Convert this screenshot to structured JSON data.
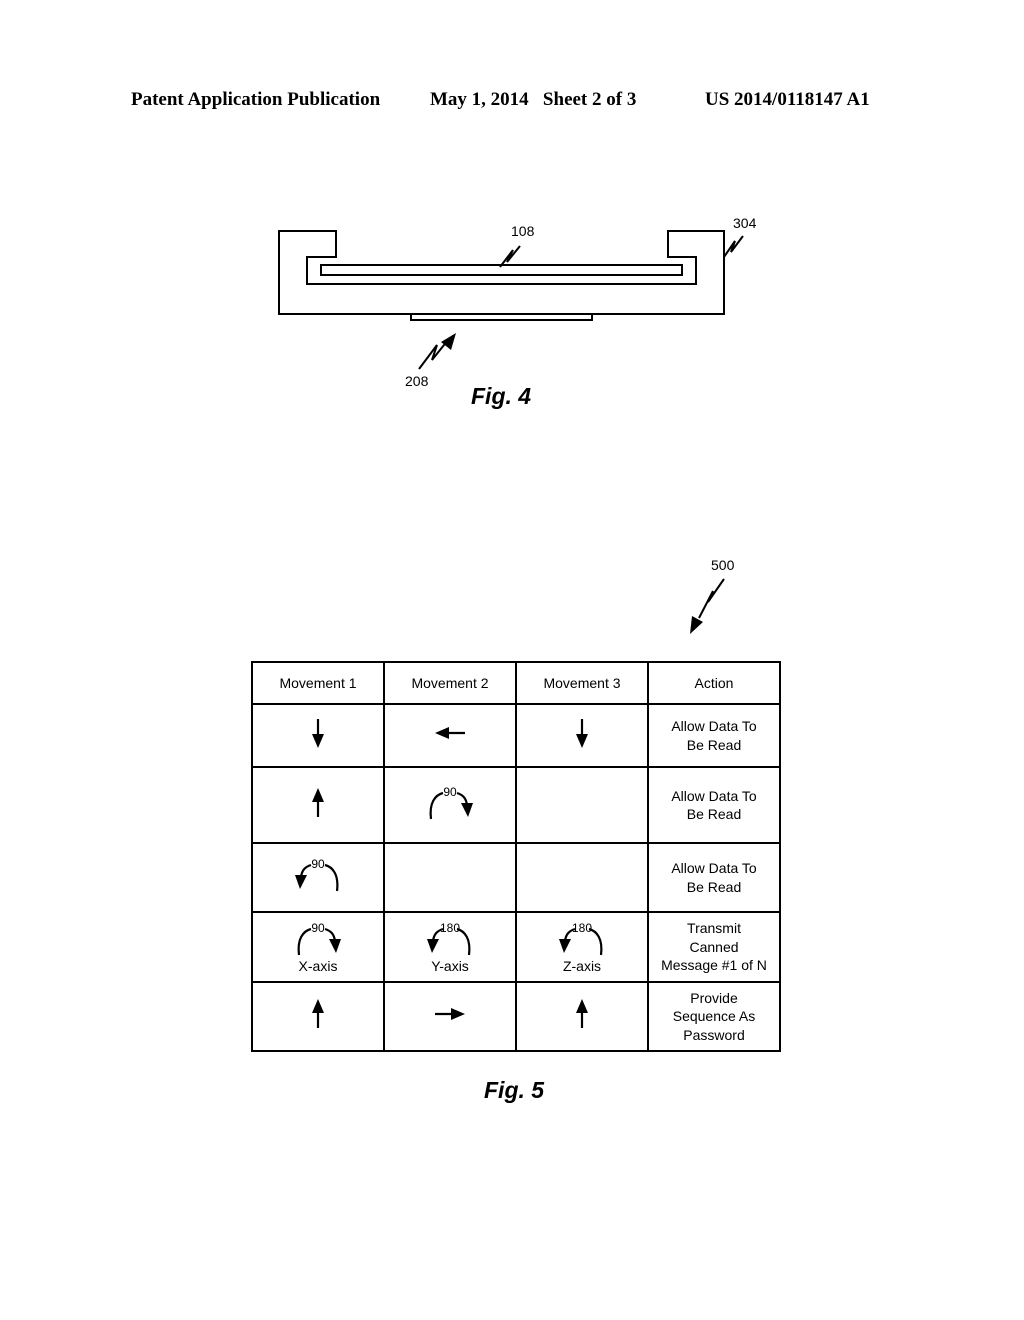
{
  "header": {
    "left": "Patent Application Publication",
    "date_sheet": "May 1, 2014   Sheet 2 of 3",
    "number": "US 2014/0118147 A1"
  },
  "fig4": {
    "caption": "Fig. 4",
    "refs": {
      "top_inner": "108",
      "housing": "304",
      "bottom_plate": "208"
    }
  },
  "fig5": {
    "caption": "Fig. 5",
    "ref": "500",
    "columns": [
      "Movement 1",
      "Movement 2",
      "Movement 3",
      "Action"
    ],
    "rows": [
      {
        "movements": [
          {
            "icon": "arrow-down",
            "degrees": "",
            "axis": ""
          },
          {
            "icon": "arrow-left",
            "degrees": "",
            "axis": ""
          },
          {
            "icon": "arrow-down",
            "degrees": "",
            "axis": ""
          }
        ],
        "action_lines": [
          "Allow Data To",
          "Be Read"
        ]
      },
      {
        "movements": [
          {
            "icon": "arrow-up",
            "degrees": "",
            "axis": ""
          },
          {
            "icon": "rotate-clockwise",
            "degrees": "90",
            "axis": ""
          },
          {
            "icon": "none",
            "degrees": "",
            "axis": ""
          }
        ],
        "action_lines": [
          "Allow Data To",
          "Be Read"
        ]
      },
      {
        "movements": [
          {
            "icon": "rotate-counterclockwise",
            "degrees": "90",
            "axis": ""
          },
          {
            "icon": "none",
            "degrees": "",
            "axis": ""
          },
          {
            "icon": "none",
            "degrees": "",
            "axis": ""
          }
        ],
        "action_lines": [
          "Allow Data To",
          "Be Read"
        ]
      },
      {
        "movements": [
          {
            "icon": "rotate-clockwise",
            "degrees": "90",
            "axis": "X-axis"
          },
          {
            "icon": "rotate-counterclockwise",
            "degrees": "180",
            "axis": "Y-axis"
          },
          {
            "icon": "rotate-counterclockwise",
            "degrees": "180",
            "axis": "Z-axis"
          }
        ],
        "action_lines": [
          "Transmit",
          "Canned",
          "Message #1 of N"
        ]
      },
      {
        "movements": [
          {
            "icon": "arrow-up",
            "degrees": "",
            "axis": ""
          },
          {
            "icon": "arrow-right",
            "degrees": "",
            "axis": ""
          },
          {
            "icon": "arrow-up",
            "degrees": "",
            "axis": ""
          }
        ],
        "action_lines": [
          "Provide",
          "Sequence As",
          "Password"
        ]
      }
    ]
  }
}
